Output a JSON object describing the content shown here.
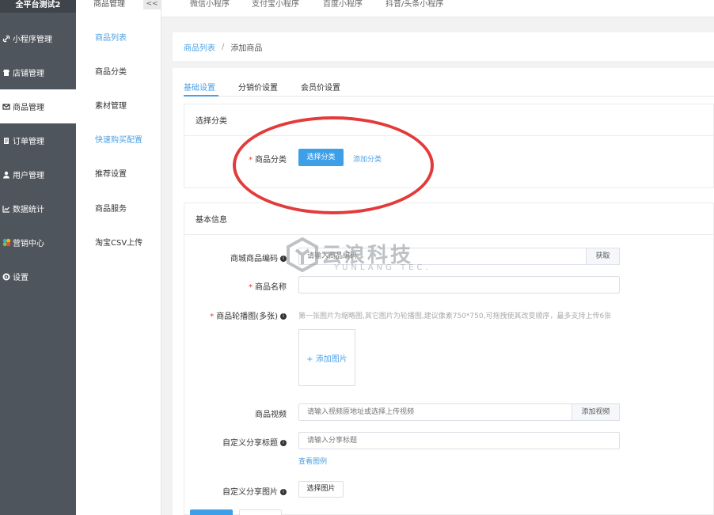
{
  "brand": "全平台测试2",
  "sidebar": {
    "items": [
      {
        "label": "小程序管理",
        "icon": "link-icon"
      },
      {
        "label": "店铺管理",
        "icon": "shop-icon"
      },
      {
        "label": "商品管理",
        "icon": "mail-icon"
      },
      {
        "label": "订单管理",
        "icon": "order-icon"
      },
      {
        "label": "用户管理",
        "icon": "user-icon"
      },
      {
        "label": "数据统计",
        "icon": "chart-icon"
      },
      {
        "label": "营销中心",
        "icon": "marketing-icon"
      },
      {
        "label": "设置",
        "icon": "gear-icon"
      }
    ]
  },
  "submenu": {
    "title": "商品管理",
    "collapse": "<<",
    "items": [
      {
        "label": "商品列表"
      },
      {
        "label": "商品分类"
      },
      {
        "label": "素材管理"
      },
      {
        "label": "快速购买配置"
      },
      {
        "label": "推荐设置"
      },
      {
        "label": "商品服务"
      },
      {
        "label": "淘宝CSV上传"
      }
    ]
  },
  "topbar": {
    "tabs": [
      "微信小程序",
      "支付宝小程序",
      "百度小程序",
      "抖音/头条小程序"
    ]
  },
  "breadcrumb": {
    "parent": "商品列表",
    "separator": "/",
    "current": "添加商品"
  },
  "tabs": [
    "基础设置",
    "分销价设置",
    "会员价设置"
  ],
  "category_card": {
    "title": "选择分类",
    "field_label": "商品分类",
    "select_button": "选择分类",
    "add_link": "添加分类"
  },
  "basic_card": {
    "title": "基本信息",
    "code_label": "商城商品编码",
    "code_placeholder": "请输入商品编码",
    "code_button": "获取",
    "name_label": "商品名称",
    "carousel_label": "商品轮播图(多张)",
    "carousel_hint": "第一张图片为缩略图,其它图片为轮播图,建议像素750*750,可拖拽使其改变顺序，最多支持上传6张",
    "add_image": "+ 添加图片",
    "video_label": "商品视频",
    "video_placeholder": "请输入视频原地址或选择上传视频",
    "video_button": "添加视频",
    "share_title_label": "自定义分享标题",
    "share_title_placeholder": "请输入分享标题",
    "share_example_link": "查看图例",
    "share_image_label": "自定义分享图片",
    "share_image_button": "选择图片"
  },
  "watermark": {
    "main": "云浪科技",
    "sub": "YUNLANG TEC."
  },
  "colors": {
    "accent": "#3d9fe8",
    "sidebar": "#4f555c",
    "highlight_ring": "#e33b3b"
  }
}
